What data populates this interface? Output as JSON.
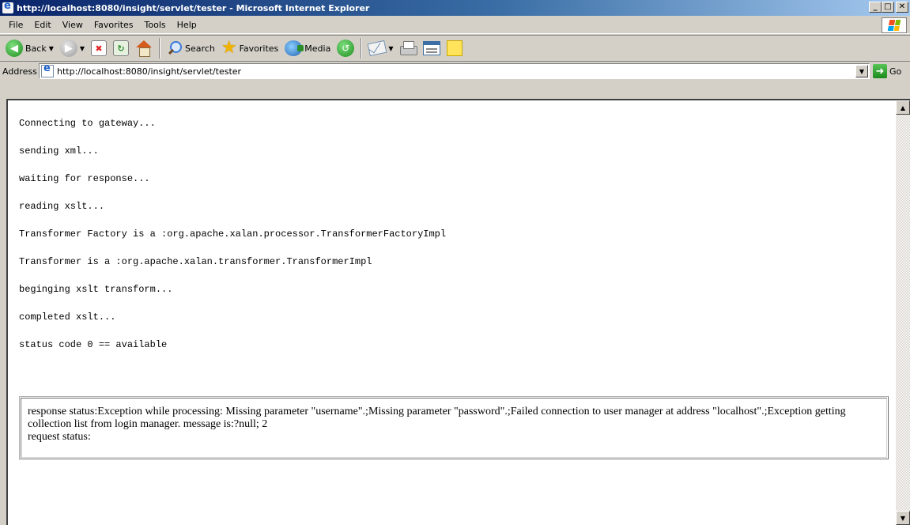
{
  "window": {
    "title": "http://localhost:8080/insight/servlet/tester - Microsoft Internet Explorer",
    "minimize": "_",
    "maximize": "□",
    "close": "✕"
  },
  "menu": {
    "items": [
      "File",
      "Edit",
      "View",
      "Favorites",
      "Tools",
      "Help"
    ]
  },
  "toolbar": {
    "back_label": "Back",
    "search_label": "Search",
    "favorites_label": "Favorites",
    "media_label": "Media"
  },
  "address": {
    "label": "Address",
    "url": "http://localhost:8080/insight/servlet/tester",
    "go_label": "Go"
  },
  "content": {
    "log_lines": [
      "Connecting to gateway...",
      "sending xml...",
      "waiting for response...",
      "reading xslt...",
      "Transformer Factory is a :org.apache.xalan.processor.TransformerFactoryImpl",
      "Transformer is a :org.apache.xalan.transformer.TransformerImpl",
      "beginging xslt transform...",
      "completed xslt...",
      "status code 0 == available"
    ],
    "response_status": "response status:Exception while processing: Missing parameter \"username\".;Missing parameter \"password\".;Failed connection to user manager at address \"localhost\".;Exception getting collection list from login manager. message is:?null; 2",
    "request_status": "request status:"
  }
}
